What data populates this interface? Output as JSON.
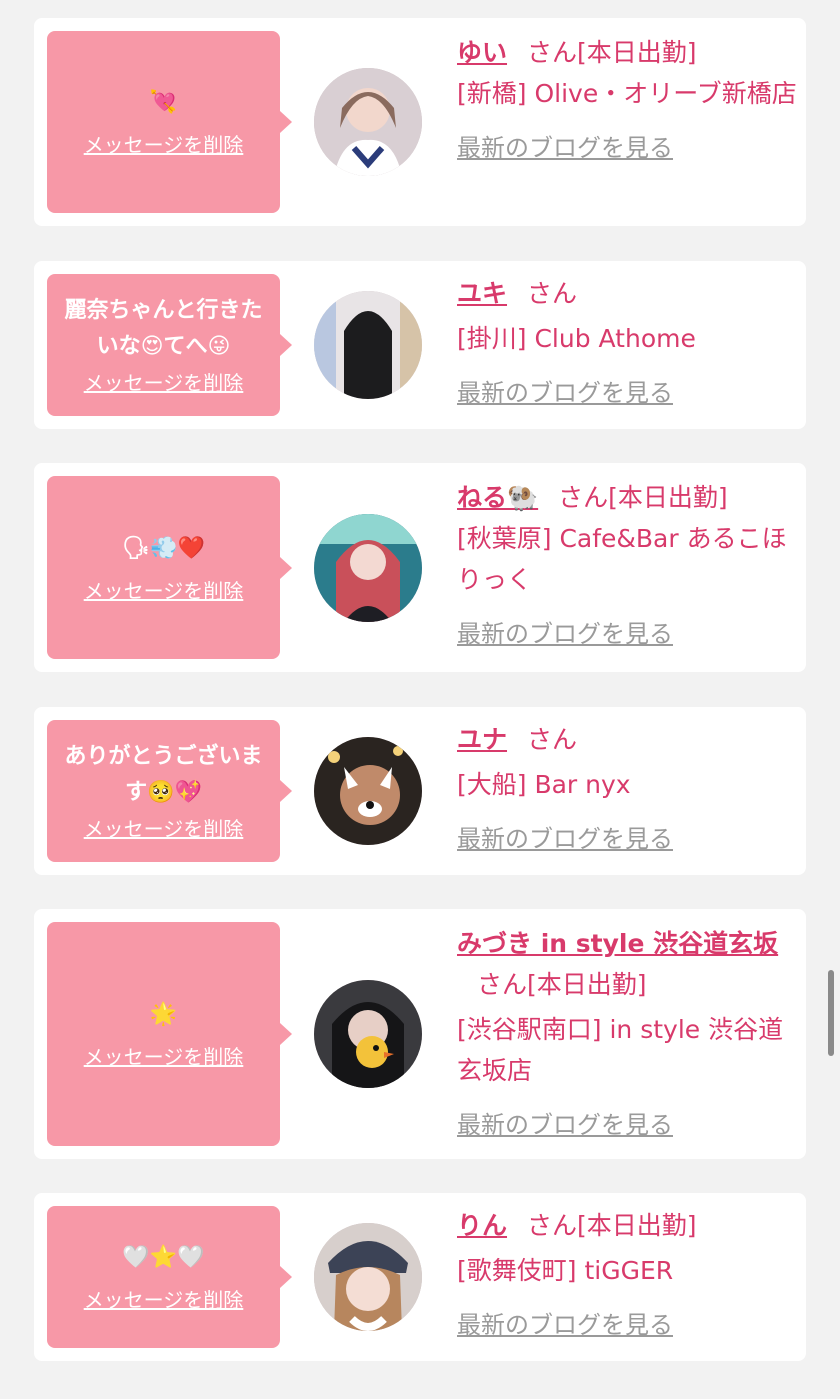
{
  "delete_label": "メッセージを削除",
  "blog_label": "最新のブログを見る",
  "suffix_san": "さん",
  "colors": {
    "page_bg": "#f2f2f2",
    "card_bg": "#ffffff",
    "bubble_bg": "#f798a7",
    "accent_pink": "#d83a6b",
    "link_gray": "#9a9a9a"
  },
  "entries": [
    {
      "message": "💘",
      "name": "ゆい",
      "badge": "[本日出勤]",
      "shop": "[新橋] Olive・オリーブ新橋店"
    },
    {
      "message": "麗奈ちゃんと行きたいな😍てへ😜",
      "name": "ユキ",
      "badge": "",
      "shop": "[掛川] Club Athome"
    },
    {
      "message": "🗣💨❤️",
      "name": "ねる🐏",
      "badge": "[本日出勤]",
      "shop": "[秋葉原] Cafe&Bar あるこほりっく"
    },
    {
      "message": "ありがとうございます🥺💖",
      "name": "ユナ",
      "badge": "",
      "shop": "[大船] Bar nyx"
    },
    {
      "message": "🌟",
      "name": "みづき in style 渋谷道玄坂",
      "badge": "[本日出勤]",
      "shop": "[渋谷駅南口] in style 渋谷道玄坂店"
    },
    {
      "message": "🤍⭐🤍",
      "name": "りん",
      "badge": "[本日出勤]",
      "shop": "[歌舞伎町] tiGGER"
    }
  ]
}
